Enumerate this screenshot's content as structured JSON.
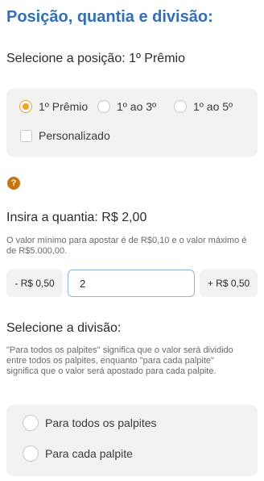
{
  "title": "Posição, quantia e divisão:",
  "position": {
    "heading": "Selecione a posição: 1º Prêmio",
    "options": [
      {
        "label": "1º Prêmio",
        "selected": true
      },
      {
        "label": "1º ao 3º",
        "selected": false
      },
      {
        "label": "1º ao 5º",
        "selected": false
      }
    ],
    "custom_label": "Personalizado"
  },
  "help_icon": "question-icon",
  "amount": {
    "heading": "Insira a quantia: R$ 2,00",
    "note": "O valor mínimo para apostar é de R$0,10 e o valor máximo é de R$5.000,00.",
    "decrement_label": "- R$ 0,50",
    "value": "2",
    "increment_label": "+ R$ 0,50"
  },
  "division": {
    "heading": "Selecione a divisão:",
    "description": "\"Para todos os palpites\" significa que o valor será dividido entre todos os palpites, enquanto \"para cada palpite\" significa que o valor será apostado para cada palpite.",
    "options": [
      {
        "label": "Para todos os palpites",
        "selected": false
      },
      {
        "label": "Para cada palpite",
        "selected": false
      }
    ]
  },
  "colors": {
    "title": "#2f6fbf",
    "accent": "#f0a524",
    "help": "#c8740e"
  }
}
